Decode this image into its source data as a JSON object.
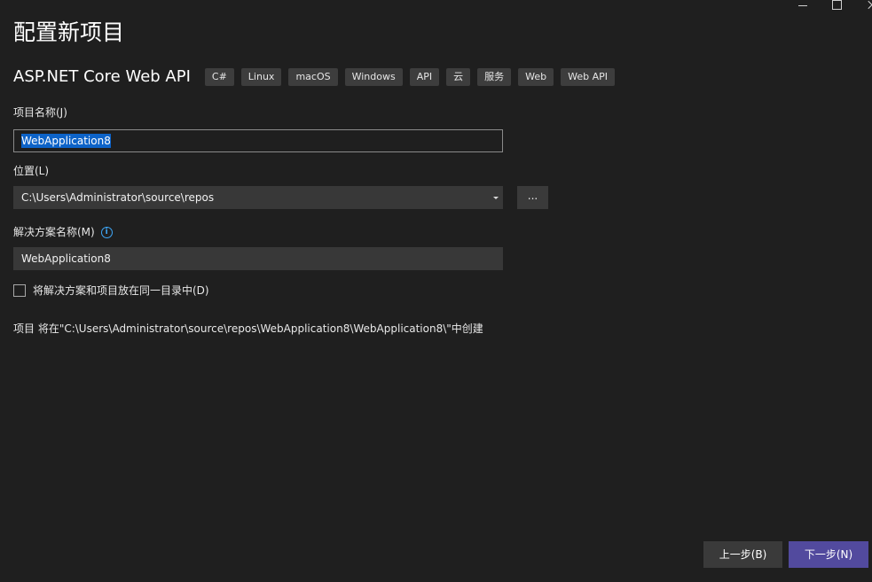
{
  "window": {
    "controls": {
      "minimize_icon": "minimize-icon",
      "maximize_icon": "maximize-icon",
      "close_icon": "close-icon"
    }
  },
  "header": {
    "title": "配置新项目",
    "template_name": "ASP.NET Core Web API",
    "tags": [
      "C#",
      "Linux",
      "macOS",
      "Windows",
      "API",
      "云",
      "服务",
      "Web",
      "Web API"
    ]
  },
  "form": {
    "project_name_label": "项目名称(J)",
    "project_name_value": "WebApplication8",
    "location_label": "位置(L)",
    "location_value": "C:\\Users\\Administrator\\source\\repos",
    "browse_label": "...",
    "solution_name_label": "解决方案名称(M)",
    "solution_name_value": "WebApplication8",
    "same_directory_label": "将解决方案和项目放在同一目录中(D)",
    "same_directory_checked": false,
    "path_note": "项目 将在\"C:\\Users\\Administrator\\source\\repos\\WebApplication8\\WebApplication8\\\"中创建"
  },
  "footer": {
    "back_label": "上一步(B)",
    "next_label": "下一步(N)"
  },
  "colors": {
    "background": "#1f1f1f",
    "selection": "#0d63c8",
    "primary_button": "#524a9e",
    "info_icon": "#3ea6f6"
  }
}
